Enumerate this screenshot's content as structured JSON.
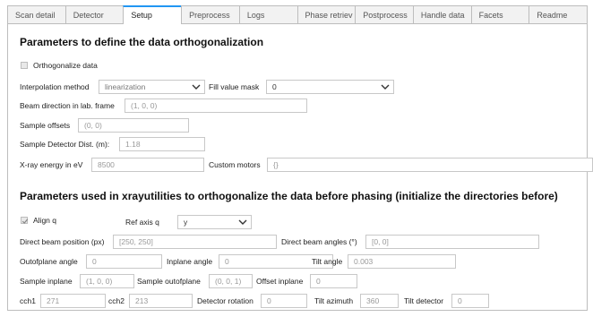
{
  "tabs": [
    {
      "label": "Scan detail"
    },
    {
      "label": "Detector"
    },
    {
      "label": "Setup"
    },
    {
      "label": "Preprocess"
    },
    {
      "label": "Logs"
    },
    {
      "label": "Phase retriev"
    },
    {
      "label": "Postprocess"
    },
    {
      "label": "Handle data"
    },
    {
      "label": "Facets"
    },
    {
      "label": "Readme"
    }
  ],
  "section1": {
    "title": "Parameters to define the data orthogonalization",
    "orthogonalize_label": "Orthogonalize data",
    "orthogonalize_checked": false,
    "interpolation_label": "Interpolation method",
    "interpolation_value": "linearization",
    "fill_value_label": "Fill value mask",
    "fill_value_value": "0",
    "beam_direction_label": "Beam direction in lab. frame",
    "beam_direction_value": "(1, 0, 0)",
    "sample_offsets_label": "Sample offsets",
    "sample_offsets_value": "(0, 0)",
    "detector_dist_label": "Sample Detector Dist. (m):",
    "detector_dist_value": "1.18",
    "xray_energy_label": "X-ray energy in eV",
    "xray_energy_value": "8500",
    "custom_motors_label": "Custom motors",
    "custom_motors_value": "{}"
  },
  "section2": {
    "title": "Parameters used in xrayutilities to orthogonalize the data before phasing (initialize the directories before)",
    "align_q_label": "Align q",
    "align_q_checked": true,
    "ref_axis_label": "Ref axis q",
    "ref_axis_value": "y",
    "direct_beam_pos_label": "Direct beam position (px)",
    "direct_beam_pos_value": "[250, 250]",
    "direct_beam_angles_label": "Direct beam angles (°)",
    "direct_beam_angles_value": "[0, 0]",
    "outofplane_angle_label": "Outofplane angle",
    "outofplane_angle_value": "0",
    "inplane_angle_label": "Inplane angle",
    "inplane_angle_value": "0",
    "tilt_angle_label": "Tilt angle",
    "tilt_angle_value": "0.003",
    "sample_inplane_label": "Sample inplane",
    "sample_inplane_value": "(1, 0, 0)",
    "sample_outofplane_label": "Sample outofplane",
    "sample_outofplane_value": "(0, 0, 1)",
    "offset_inplane_label": "Offset inplane",
    "offset_inplane_value": "0",
    "cch1_label": "cch1",
    "cch1_value": "271",
    "cch2_label": "cch2",
    "cch2_value": "213",
    "detector_rotation_label": "Detector rotation",
    "detector_rotation_value": "0",
    "tilt_azimuth_label": "Tilt azimuth",
    "tilt_azimuth_value": "360",
    "tilt_detector_label": "Tilt detector",
    "tilt_detector_value": "0"
  },
  "icons": {
    "dropdown": "chevron-down-icon",
    "checkbox_checked": "checkmark-icon"
  },
  "colors": {
    "active_tab_accent": "#2196f3",
    "input_border": "#c8c8c8",
    "placeholder_text": "#999999"
  }
}
